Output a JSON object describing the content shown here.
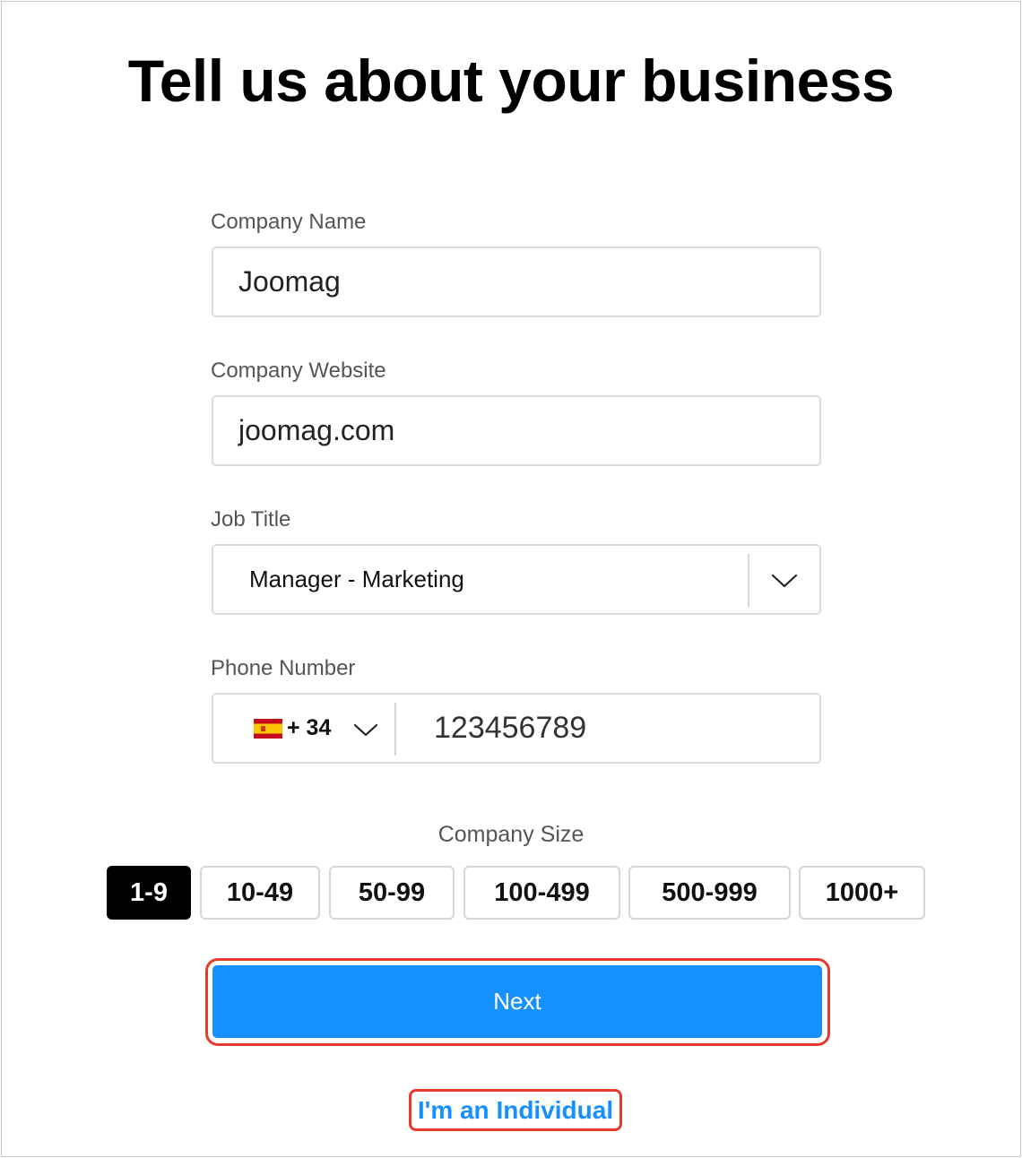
{
  "page": {
    "title": "Tell us about your business"
  },
  "form": {
    "company_name": {
      "label": "Company Name",
      "value": "Joomag"
    },
    "company_website": {
      "label": "Company Website",
      "value": "joomag.com"
    },
    "job_title": {
      "label": "Job Title",
      "value": "Manager - Marketing",
      "icon": "chevron-down-icon"
    },
    "phone": {
      "label": "Phone Number",
      "country_flag": "spain-flag-icon",
      "country_code": "+ 34",
      "value": "123456789"
    },
    "company_size": {
      "label": "Company Size",
      "options": [
        "1-9",
        "10-49",
        "50-99",
        "100-499",
        "500-999",
        "1000+"
      ],
      "selected": "1-9"
    }
  },
  "actions": {
    "next_label": "Next",
    "individual_label": "I'm an Individual"
  },
  "colors": {
    "accent": "#1690ff",
    "highlight": "#e53b2c",
    "selected_bg": "#000000"
  }
}
